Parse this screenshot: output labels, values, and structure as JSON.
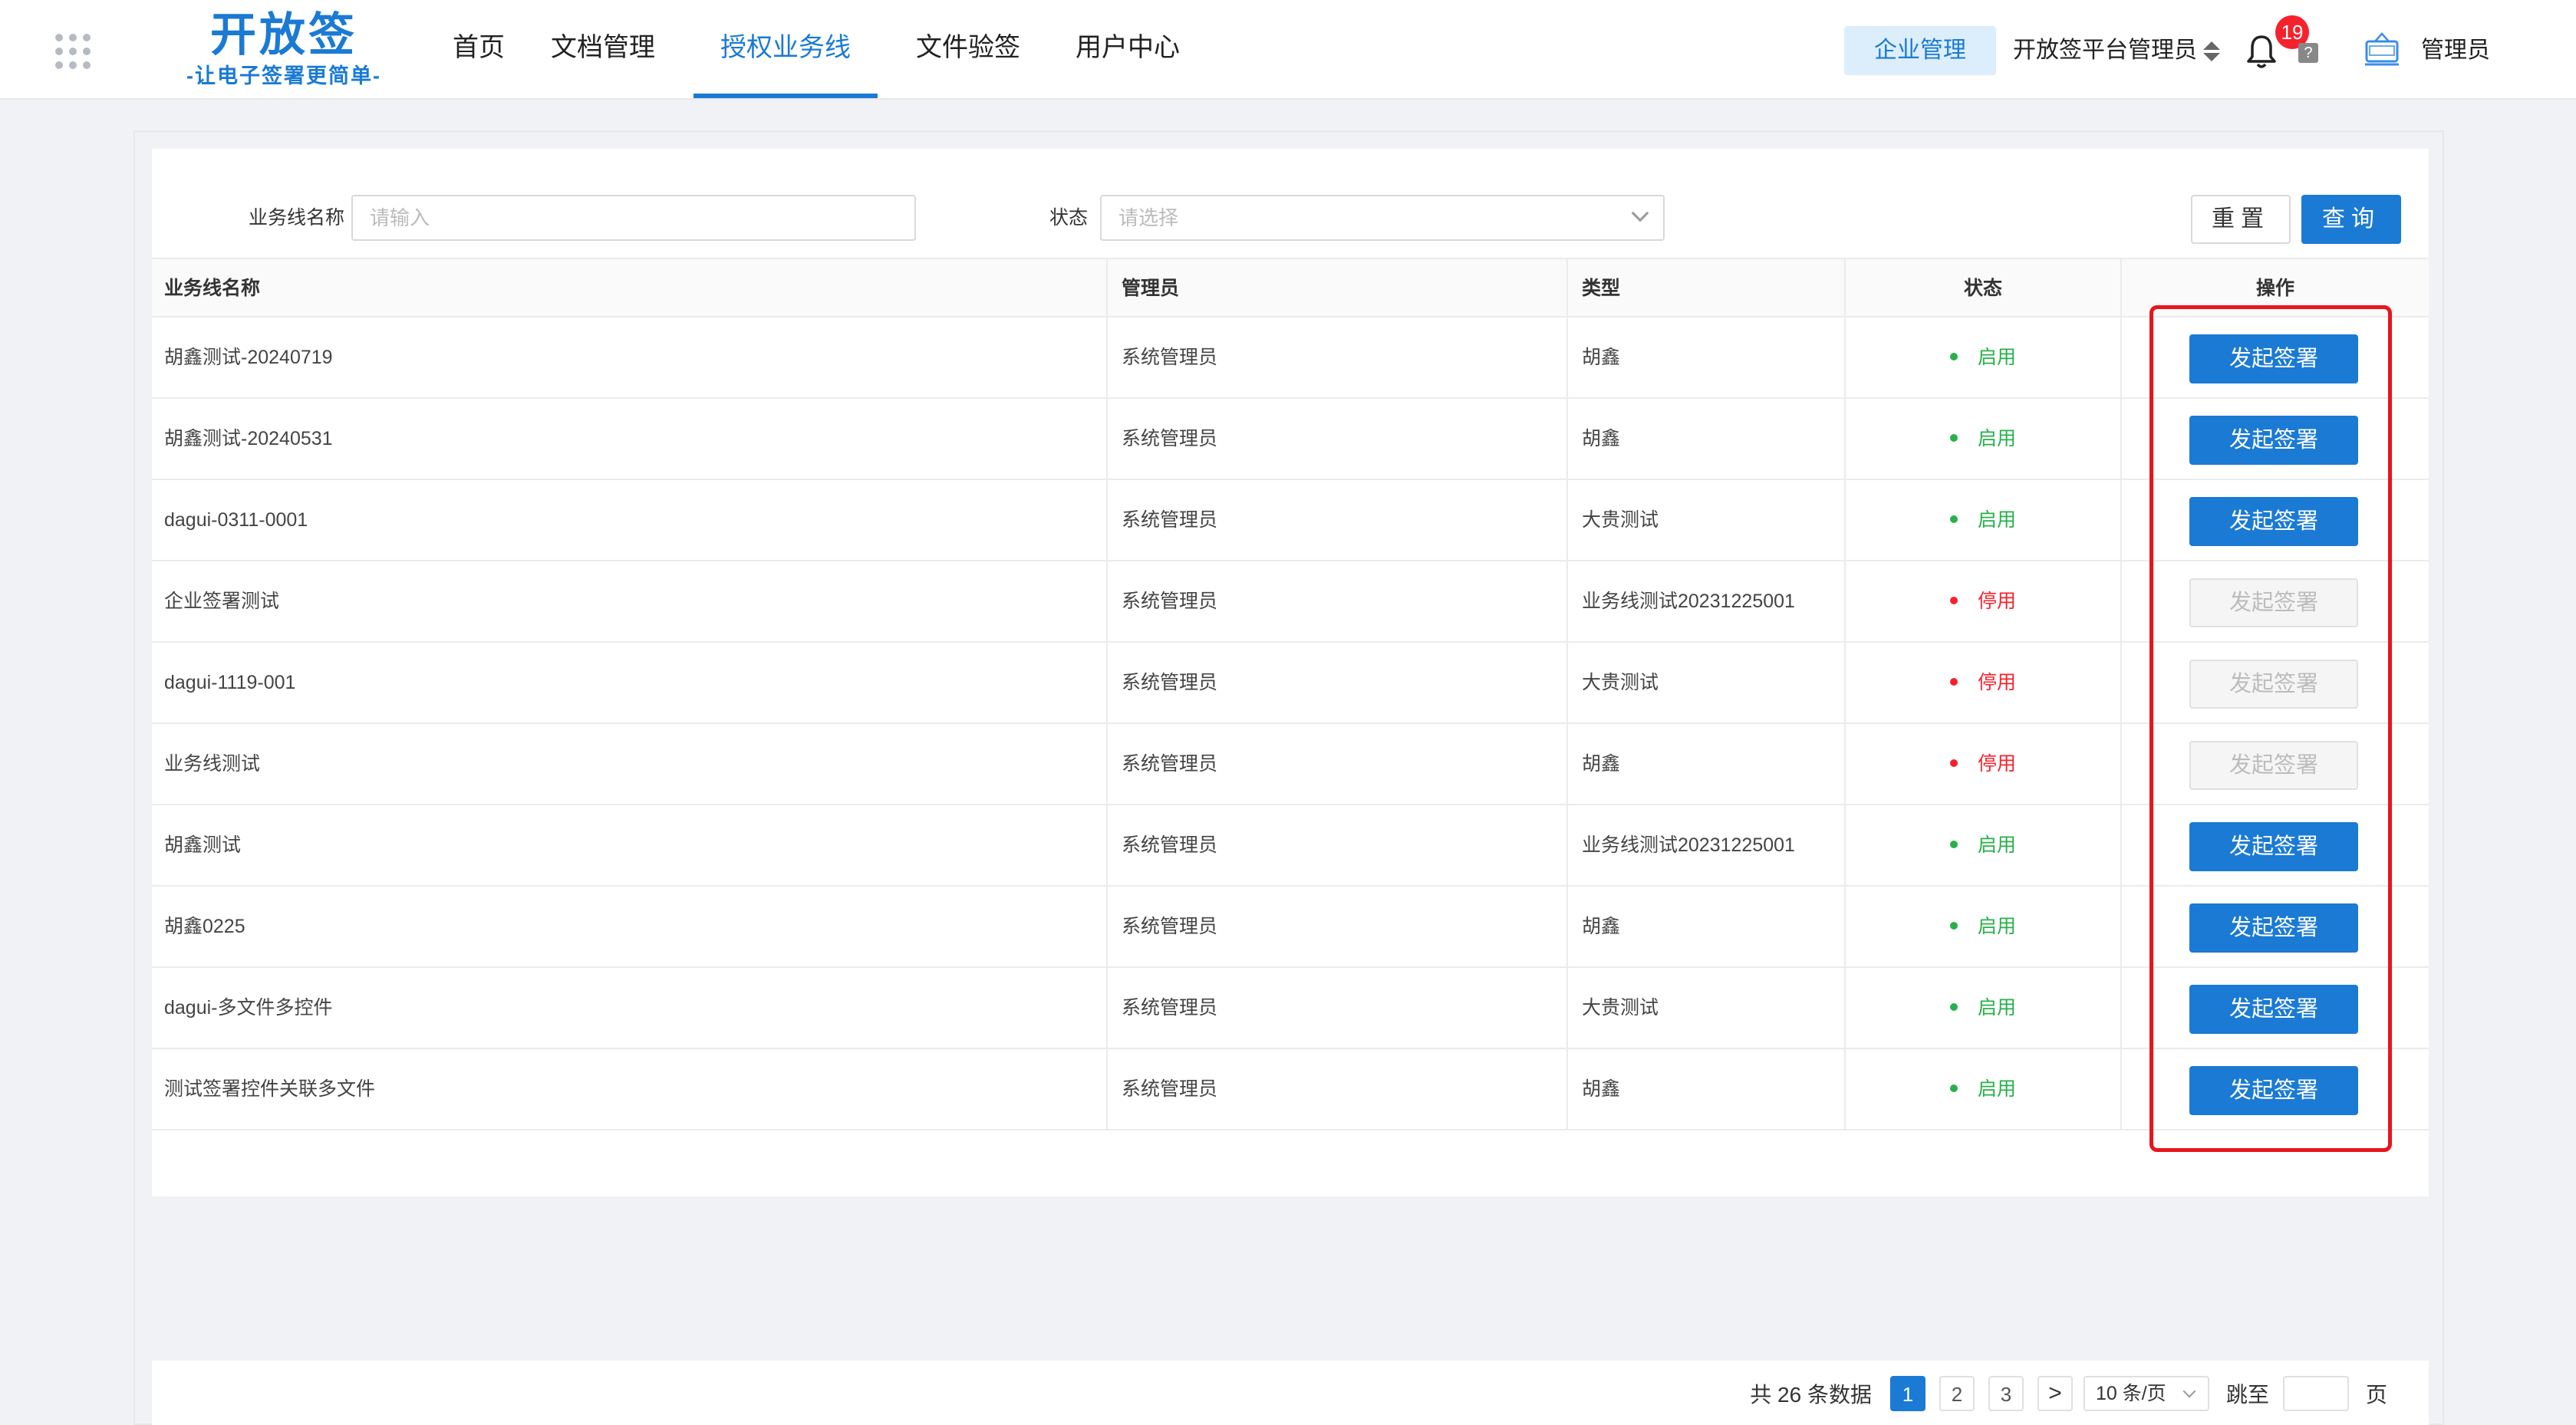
{
  "header": {
    "logo_title": "开放签",
    "logo_subtitle": "-让电子签署更简单-",
    "nav": [
      "首页",
      "文档管理",
      "授权业务线",
      "文件验签",
      "用户中心"
    ],
    "active_nav": "授权业务线",
    "enterprise_button": "企业管理",
    "account_switch": "开放签平台管理员",
    "notification_count": "19",
    "help_glyph": "?",
    "admin_label": "管理员"
  },
  "filter": {
    "name_label": "业务线名称",
    "name_placeholder": "请输入",
    "status_label": "状态",
    "status_placeholder": "请选择",
    "reset_label": "重置",
    "query_label": "查询"
  },
  "table": {
    "columns": [
      "业务线名称",
      "管理员",
      "类型",
      "状态",
      "操作"
    ],
    "rows": [
      {
        "name": "胡鑫测试-20240719",
        "admin": "系统管理员",
        "type": "胡鑫",
        "status": "启用",
        "action": "发起签署",
        "enabled": true
      },
      {
        "name": "胡鑫测试-20240531",
        "admin": "系统管理员",
        "type": "胡鑫",
        "status": "启用",
        "action": "发起签署",
        "enabled": true
      },
      {
        "name": "dagui-0311-0001",
        "admin": "系统管理员",
        "type": "大贵测试",
        "status": "启用",
        "action": "发起签署",
        "enabled": true
      },
      {
        "name": "企业签署测试",
        "admin": "系统管理员",
        "type": "业务线测试20231225001",
        "status": "停用",
        "action": "发起签署",
        "enabled": false
      },
      {
        "name": "dagui-1119-001",
        "admin": "系统管理员",
        "type": "大贵测试",
        "status": "停用",
        "action": "发起签署",
        "enabled": false
      },
      {
        "name": "业务线测试",
        "admin": "系统管理员",
        "type": "胡鑫",
        "status": "停用",
        "action": "发起签署",
        "enabled": false
      },
      {
        "name": "胡鑫测试",
        "admin": "系统管理员",
        "type": "业务线测试20231225001",
        "status": "启用",
        "action": "发起签署",
        "enabled": true
      },
      {
        "name": "胡鑫0225",
        "admin": "系统管理员",
        "type": "胡鑫",
        "status": "启用",
        "action": "发起签署",
        "enabled": true
      },
      {
        "name": "dagui-多文件多控件",
        "admin": "系统管理员",
        "type": "大贵测试",
        "status": "启用",
        "action": "发起签署",
        "enabled": true
      },
      {
        "name": "测试签署控件关联多文件",
        "admin": "系统管理员",
        "type": "胡鑫",
        "status": "启用",
        "action": "发起签署",
        "enabled": true
      }
    ]
  },
  "pagination": {
    "total_text": "共 26 条数据",
    "pages": [
      "1",
      "2",
      "3"
    ],
    "current_page": "1",
    "next_glyph": ">",
    "page_size": "10 条/页",
    "jump_label": "跳至",
    "page_suffix": "页"
  },
  "colors": {
    "primary": "#1a7ad4",
    "enabled": "#28b04b",
    "disabled": "#f5222d",
    "highlight": "#e8151c"
  }
}
